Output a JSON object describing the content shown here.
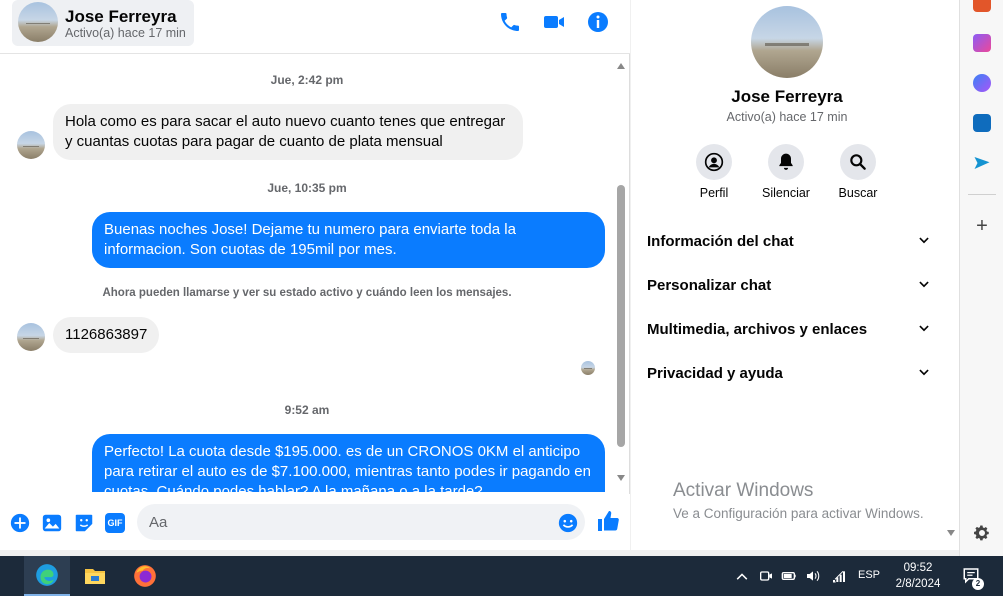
{
  "header": {
    "contact_name": "Jose Ferreyra",
    "contact_status": "Activo(a) hace 17 min",
    "icons": [
      "phone-icon",
      "video-icon",
      "info-icon"
    ]
  },
  "messages": [
    {
      "type": "timestamp",
      "text": "Jue, 2:42 pm"
    },
    {
      "type": "incoming",
      "text": "Hola como es para sacar el auto nuevo cuanto tenes que entregar y cuantas cuotas para pagar de cuanto de plata mensual"
    },
    {
      "type": "timestamp",
      "text": "Jue, 10:35 pm"
    },
    {
      "type": "outgoing",
      "text": "Buenas noches Jose! Dejame tu numero para enviarte toda la informacion. Son cuotas de 195mil por mes."
    },
    {
      "type": "notice",
      "text": "Ahora pueden llamarse y ver su estado activo y cuándo leen los mensajes."
    },
    {
      "type": "incoming",
      "text": "1126863897"
    },
    {
      "type": "timestamp",
      "text": "9:52 am"
    },
    {
      "type": "outgoing",
      "text": "Perfecto! La cuota desde $195.000. es de un CRONOS 0KM el anticipo para retirar el auto es de $7.100.000, mientras tanto podes ir pagando en cuotas. Cuándo podes hablar? A la mañana o a la tarde?"
    }
  ],
  "composer": {
    "placeholder": "Aa",
    "gif_label": "GIF",
    "icons": [
      "plus-circle-icon",
      "image-icon",
      "sticker-icon",
      "gif-icon",
      "emoji-icon",
      "thumbs-up-icon"
    ]
  },
  "info": {
    "name": "Jose Ferreyra",
    "status": "Activo(a) hace 17 min",
    "actions": [
      {
        "label": "Perfil",
        "icon": "profile-icon"
      },
      {
        "label": "Silenciar",
        "icon": "bell-icon"
      },
      {
        "label": "Buscar",
        "icon": "search-icon"
      }
    ],
    "sections": [
      "Información del chat",
      "Personalizar chat",
      "Multimedia, archivos y enlaces",
      "Privacidad y ayuda"
    ]
  },
  "watermark": {
    "title": "Activar Windows",
    "subtitle": "Ve a Configuración para activar Windows."
  },
  "edge_sidebar": {
    "icons": [
      "toolbox-icon",
      "games-icon",
      "copilot-icon",
      "outlook-icon",
      "send-icon",
      "add-icon",
      "settings-icon"
    ]
  },
  "taskbar": {
    "apps": [
      "edge-icon",
      "file-explorer-icon",
      "firefox-icon"
    ],
    "language": "ESP",
    "time": "09:52",
    "date": "2/8/2024",
    "notification_count": "2"
  }
}
